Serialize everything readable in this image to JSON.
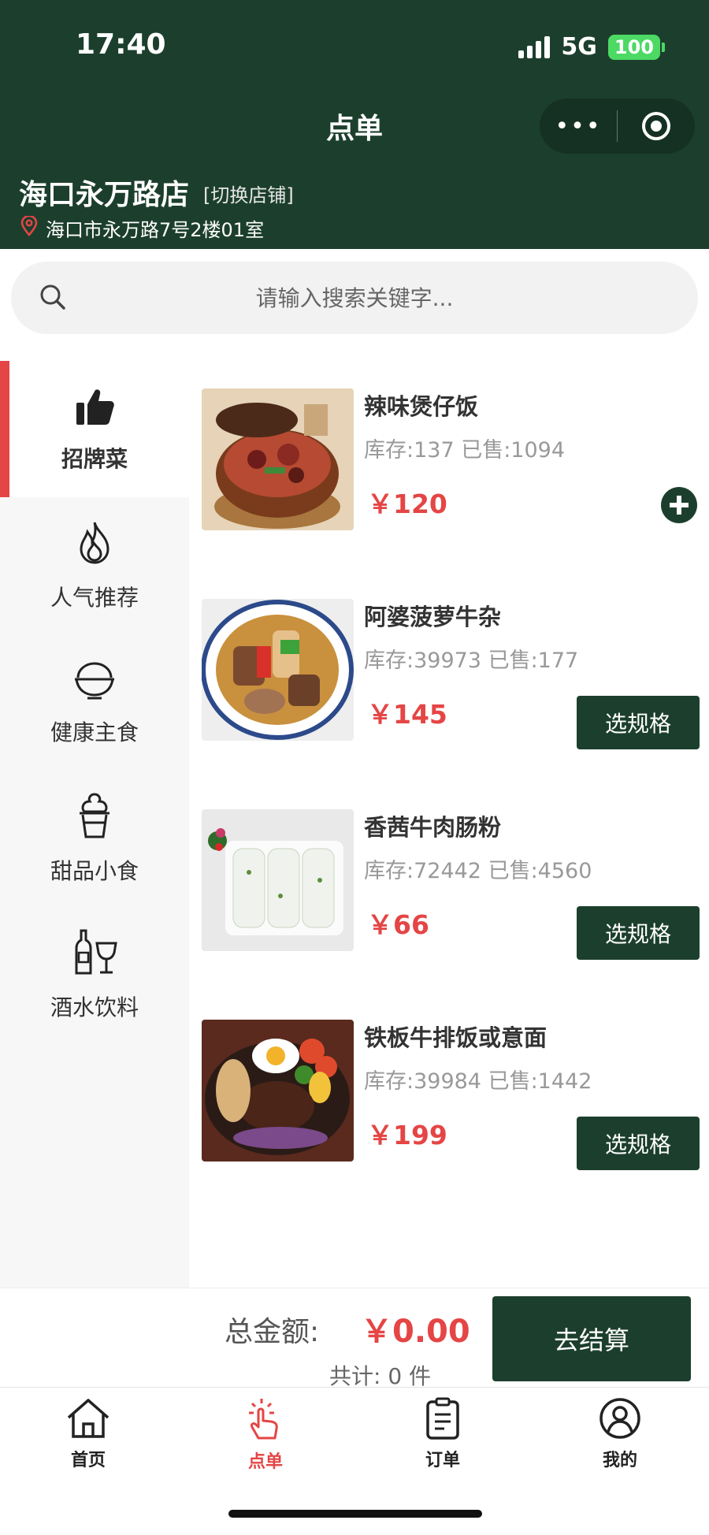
{
  "status_bar": {
    "time": "17:40",
    "network": "5G",
    "battery": "100"
  },
  "navbar": {
    "title": "点单",
    "capsule_more": "•••"
  },
  "store": {
    "name": "海口永万路店",
    "switch_label": "[切换店铺]",
    "address": "海口市永万路7号2楼01室"
  },
  "search": {
    "placeholder": "请输入搜索关键字..."
  },
  "categories": [
    {
      "label": "招牌菜",
      "icon": "thumbs-up-icon",
      "active": true
    },
    {
      "label": "人气推荐",
      "icon": "flame-icon"
    },
    {
      "label": "健康主食",
      "icon": "rice-bowl-icon"
    },
    {
      "label": "甜品小食",
      "icon": "ice-cream-icon"
    },
    {
      "label": "酒水饮料",
      "icon": "wine-icon"
    }
  ],
  "dishes": [
    {
      "name": "辣味煲仔饭",
      "stock": "库存:137 已售:1094",
      "price": "￥120",
      "action": "add"
    },
    {
      "name": "阿婆菠萝牛杂",
      "stock": "库存:39973 已售:177",
      "price": "￥145",
      "action": "选规格"
    },
    {
      "name": "香茜牛肉肠粉",
      "stock": "库存:72442 已售:4560",
      "price": "￥66",
      "action": "选规格"
    },
    {
      "name": "铁板牛排饭或意面",
      "stock": "库存:39984 已售:1442",
      "price": "￥199",
      "action": "选规格"
    }
  ],
  "cart": {
    "total_label": "总金额:",
    "total_amount": "￥0.00",
    "count": "共计: 0 件",
    "checkout": "去结算"
  },
  "tabs": [
    {
      "label": "首页",
      "icon": "home-icon"
    },
    {
      "label": "点单",
      "icon": "tap-hand-icon",
      "active": true
    },
    {
      "label": "订单",
      "icon": "clipboard-icon"
    },
    {
      "label": "我的",
      "icon": "user-icon"
    }
  ],
  "colors": {
    "primary": "#1c3f2d",
    "accent": "#e54545",
    "battery": "#4cd964"
  }
}
